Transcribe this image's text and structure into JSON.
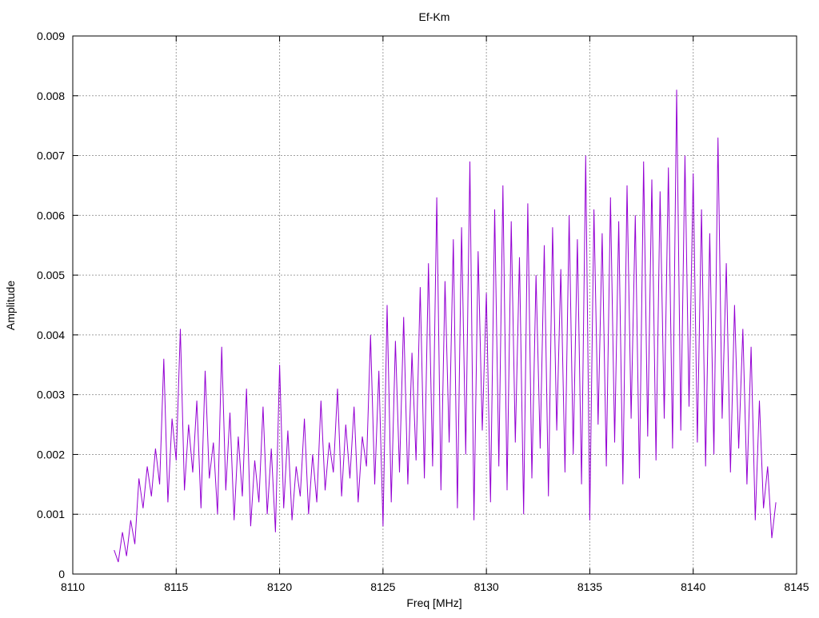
{
  "chart_data": {
    "type": "line",
    "title": "Ef-Km",
    "xlabel": "Freq [MHz]",
    "ylabel": "Amplitude",
    "xlim": [
      8110,
      8145
    ],
    "ylim": [
      0,
      0.009
    ],
    "x_ticks": [
      8110,
      8115,
      8120,
      8125,
      8130,
      8135,
      8140,
      8145
    ],
    "y_ticks": [
      0,
      0.001,
      0.002,
      0.003,
      0.004,
      0.005,
      0.006,
      0.007,
      0.008,
      0.009
    ],
    "x_tick_labels": [
      "8110",
      "8115",
      "8120",
      "8125",
      "8130",
      "8135",
      "8140",
      "8145"
    ],
    "y_tick_labels": [
      "0",
      "0.001",
      "0.002",
      "0.003",
      "0.004",
      "0.005",
      "0.006",
      "0.007",
      "0.008",
      "0.009"
    ],
    "grid": true,
    "legend": "none",
    "series": [
      {
        "color": "#9400d3",
        "x": [
          8112.0,
          8112.2,
          8112.4,
          8112.6,
          8112.8,
          8113.0,
          8113.2,
          8113.4,
          8113.6,
          8113.8,
          8114.0,
          8114.2,
          8114.4,
          8114.6,
          8114.8,
          8115.0,
          8115.2,
          8115.4,
          8115.6,
          8115.8,
          8116.0,
          8116.2,
          8116.4,
          8116.6,
          8116.8,
          8117.0,
          8117.2,
          8117.4,
          8117.6,
          8117.8,
          8118.0,
          8118.2,
          8118.4,
          8118.6,
          8118.8,
          8119.0,
          8119.2,
          8119.4,
          8119.6,
          8119.8,
          8120.0,
          8120.2,
          8120.4,
          8120.6,
          8120.8,
          8121.0,
          8121.2,
          8121.4,
          8121.6,
          8121.8,
          8122.0,
          8122.2,
          8122.4,
          8122.6,
          8122.8,
          8123.0,
          8123.2,
          8123.4,
          8123.6,
          8123.8,
          8124.0,
          8124.2,
          8124.4,
          8124.6,
          8124.8,
          8125.0,
          8125.2,
          8125.4,
          8125.6,
          8125.8,
          8126.0,
          8126.2,
          8126.4,
          8126.6,
          8126.8,
          8127.0,
          8127.2,
          8127.4,
          8127.6,
          8127.8,
          8128.0,
          8128.2,
          8128.4,
          8128.6,
          8128.8,
          8129.0,
          8129.2,
          8129.4,
          8129.6,
          8129.8,
          8130.0,
          8130.2,
          8130.4,
          8130.6,
          8130.8,
          8131.0,
          8131.2,
          8131.4,
          8131.6,
          8131.8,
          8132.0,
          8132.2,
          8132.4,
          8132.6,
          8132.8,
          8133.0,
          8133.2,
          8133.4,
          8133.6,
          8133.8,
          8134.0,
          8134.2,
          8134.4,
          8134.6,
          8134.8,
          8135.0,
          8135.2,
          8135.4,
          8135.6,
          8135.8,
          8136.0,
          8136.2,
          8136.4,
          8136.6,
          8136.8,
          8137.0,
          8137.2,
          8137.4,
          8137.6,
          8137.8,
          8138.0,
          8138.2,
          8138.4,
          8138.6,
          8138.8,
          8139.0,
          8139.2,
          8139.4,
          8139.6,
          8139.8,
          8140.0,
          8140.2,
          8140.4,
          8140.6,
          8140.8,
          8141.0,
          8141.2,
          8141.4,
          8141.6,
          8141.8,
          8142.0,
          8142.2,
          8142.4,
          8142.6,
          8142.8,
          8143.0,
          8143.2,
          8143.4,
          8143.6,
          8143.8,
          8144.0
        ],
        "y": [
          0.0004,
          0.0002,
          0.0007,
          0.0003,
          0.0009,
          0.0005,
          0.0016,
          0.0011,
          0.0018,
          0.0013,
          0.0021,
          0.0015,
          0.0036,
          0.0012,
          0.0026,
          0.0019,
          0.0041,
          0.0014,
          0.0025,
          0.0017,
          0.0029,
          0.0011,
          0.0034,
          0.0016,
          0.0022,
          0.001,
          0.0038,
          0.0014,
          0.0027,
          0.0009,
          0.0023,
          0.0013,
          0.0031,
          0.0008,
          0.0019,
          0.0012,
          0.0028,
          0.001,
          0.0021,
          0.0007,
          0.0035,
          0.0011,
          0.0024,
          0.0009,
          0.0018,
          0.0013,
          0.0026,
          0.001,
          0.002,
          0.0012,
          0.0029,
          0.0014,
          0.0022,
          0.0017,
          0.0031,
          0.0013,
          0.0025,
          0.0016,
          0.0028,
          0.0012,
          0.0023,
          0.0018,
          0.004,
          0.0015,
          0.0034,
          0.0008,
          0.0045,
          0.0012,
          0.0039,
          0.0017,
          0.0043,
          0.0015,
          0.0037,
          0.0019,
          0.0048,
          0.0016,
          0.0052,
          0.0018,
          0.0063,
          0.0014,
          0.0049,
          0.0022,
          0.0056,
          0.0011,
          0.0058,
          0.002,
          0.0069,
          0.0009,
          0.0054,
          0.0024,
          0.0047,
          0.0012,
          0.0061,
          0.0018,
          0.0065,
          0.0014,
          0.0059,
          0.0022,
          0.0053,
          0.001,
          0.0062,
          0.0016,
          0.005,
          0.0021,
          0.0055,
          0.0013,
          0.0058,
          0.0024,
          0.0051,
          0.0017,
          0.006,
          0.002,
          0.0056,
          0.0015,
          0.007,
          0.0009,
          0.0061,
          0.0025,
          0.0057,
          0.0018,
          0.0063,
          0.0022,
          0.0059,
          0.0015,
          0.0065,
          0.0026,
          0.006,
          0.0016,
          0.0069,
          0.0023,
          0.0066,
          0.0019,
          0.0064,
          0.0026,
          0.0068,
          0.0021,
          0.0081,
          0.0024,
          0.007,
          0.0028,
          0.0067,
          0.0022,
          0.0061,
          0.0018,
          0.0057,
          0.002,
          0.0073,
          0.0026,
          0.0052,
          0.0017,
          0.0045,
          0.0021,
          0.0041,
          0.0015,
          0.0038,
          0.0009,
          0.0029,
          0.0011,
          0.0018,
          0.0006,
          0.0012
        ]
      }
    ]
  }
}
